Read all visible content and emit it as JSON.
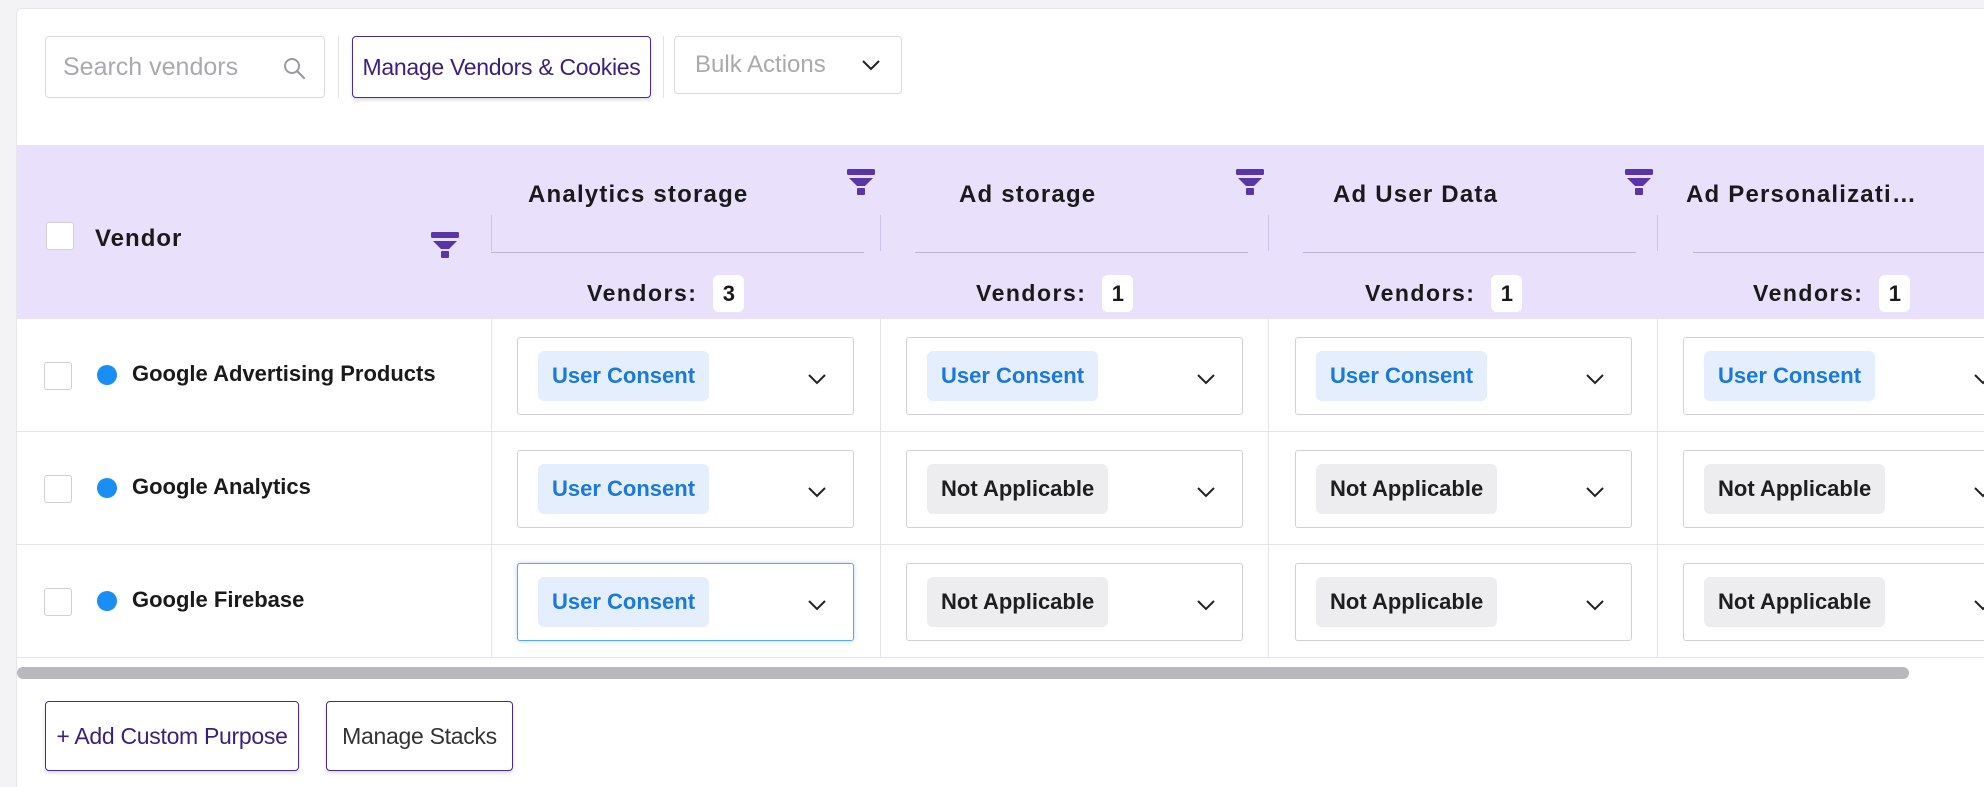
{
  "toolbar": {
    "search_placeholder": "Search vendors",
    "search_icon": "search-icon",
    "manage_label": "Manage Vendors & Cookies",
    "bulk_label": "Bulk Actions"
  },
  "table": {
    "vendor_header": "Vendor",
    "vendors_label": "Vendors:",
    "columns": [
      {
        "title": "Analytics storage",
        "count": "3"
      },
      {
        "title": "Ad storage",
        "count": "1"
      },
      {
        "title": "Ad User Data",
        "count": "1"
      },
      {
        "title": "Ad Personalizati…",
        "count": "1"
      }
    ],
    "rows": [
      {
        "vendor": "Google Advertising Products",
        "values": [
          "User Consent",
          "User Consent",
          "User Consent",
          "User Consent"
        ]
      },
      {
        "vendor": "Google Analytics",
        "values": [
          "User Consent",
          "Not Applicable",
          "Not Applicable",
          "Not Applicable"
        ]
      },
      {
        "vendor": "Google Firebase",
        "values": [
          "User Consent",
          "Not Applicable",
          "Not Applicable",
          "Not Applicable"
        ]
      }
    ]
  },
  "footer": {
    "add_label": "+ Add Custom Purpose",
    "stacks_label": "Manage Stacks"
  },
  "colors": {
    "header_bg": "#e9e0fb",
    "accent": "#4b2a8c",
    "filter_icon": "#5a35a8",
    "vendor_dot": "#1a8ef5",
    "consent_text": "#1a7ad9",
    "consent_bg": "#e4eefc",
    "na_bg": "#ededf0"
  }
}
